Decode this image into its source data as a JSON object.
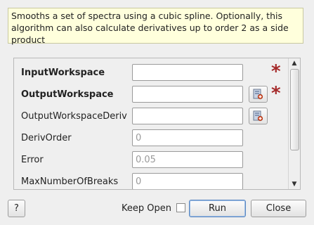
{
  "description": "Smooths a set of spectra using a cubic spline. Optionally, this algorithm can also calculate derivatives up to order 2 as a side product",
  "properties": [
    {
      "label": "InputWorkspace",
      "value": "",
      "placeholder": "",
      "required": true,
      "browse": false
    },
    {
      "label": "OutputWorkspace",
      "value": "",
      "placeholder": "",
      "required": true,
      "browse": true
    },
    {
      "label": "OutputWorkspaceDeriv",
      "value": "",
      "placeholder": "",
      "required": false,
      "browse": true
    },
    {
      "label": "DerivOrder",
      "value": "",
      "placeholder": "0",
      "required": false,
      "browse": false
    },
    {
      "label": "Error",
      "value": "",
      "placeholder": "0.05",
      "required": false,
      "browse": false
    },
    {
      "label": "MaxNumberOfBreaks",
      "value": "",
      "placeholder": "0",
      "required": false,
      "browse": false
    }
  ],
  "required_marker": "*",
  "footer": {
    "help_label": "?",
    "keep_open_label": "Keep Open",
    "keep_open_checked": false,
    "run_label": "Run",
    "close_label": "Close"
  },
  "colors": {
    "required": "#a52a2a",
    "description_bg": "#ffffdc",
    "run_border": "#5a87c0"
  },
  "icons": {
    "browse": "workspace-browse-icon",
    "scroll_up": "scroll-up-arrow-icon",
    "scroll_down": "scroll-down-arrow-icon"
  }
}
